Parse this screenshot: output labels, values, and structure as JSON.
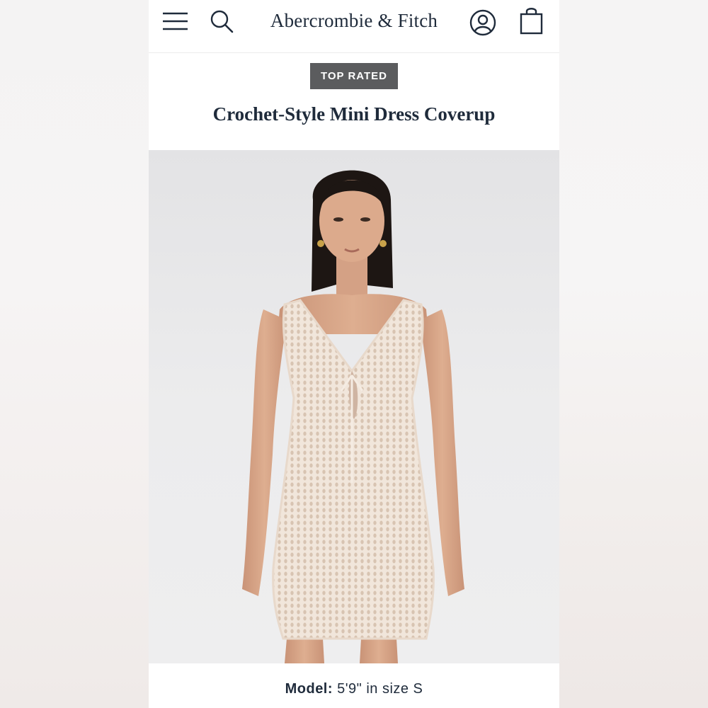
{
  "header": {
    "brand": "Abercrombie & Fitch",
    "menu_icon": "hamburger-menu-icon",
    "search_icon": "search-icon",
    "account_icon": "account-icon",
    "bag_icon": "shopping-bag-icon"
  },
  "product": {
    "badge": "TOP RATED",
    "title": "Crochet-Style Mini Dress Coverup",
    "model_label": "Model:",
    "model_info": "5'9\" in size S"
  },
  "colors": {
    "brand_navy": "#1f2b3b",
    "badge_bg": "#5b5c5e",
    "dress": "#f1e6db",
    "skin": "#d9a98a",
    "hair": "#1d1613"
  }
}
